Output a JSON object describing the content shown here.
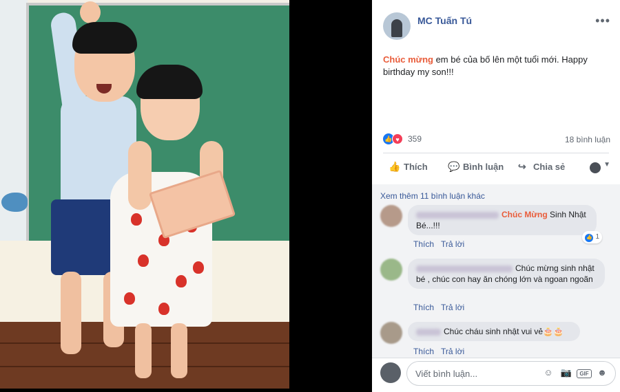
{
  "post": {
    "author": "MC Tuấn Tú",
    "more_label": "•••",
    "text_highlight": "Chúc mừng",
    "text_rest": " em bé của bố lên một tuổi mới. Happy birthday my son!!!"
  },
  "reactions": {
    "count": "359",
    "comments_label": "18 bình luận",
    "icons": [
      "like-icon",
      "love-icon"
    ]
  },
  "actions": {
    "like": "Thích",
    "comment": "Bình luận",
    "share": "Chia sẻ"
  },
  "comments": {
    "more_label": "Xem thêm 11 bình luận khác",
    "items": [
      {
        "highlight": "Chúc Mừng",
        "text": " Sinh Nhật Bé...!!!",
        "like": "Thích",
        "reply": "Trả lời",
        "react_count": "1"
      },
      {
        "text": "Chúc mừng sinh nhật bé , chúc con hay ăn chóng lớn và ngoan ngoãn",
        "like": "Thích",
        "reply": "Trả lời"
      },
      {
        "text": "Chúc cháu sinh nhật vui vẻ🎂🎂",
        "like": "Thích",
        "reply": "Trả lời"
      }
    ]
  },
  "composer": {
    "placeholder": "Viết bình luận...",
    "icons": [
      "emoji-icon",
      "camera-icon",
      "gif-icon",
      "sticker-icon"
    ],
    "gif_label": "GIF"
  },
  "colors": {
    "link": "#385898",
    "highlight": "#e95c3a",
    "like_blue": "#1877f2",
    "love_red": "#f33e58"
  }
}
